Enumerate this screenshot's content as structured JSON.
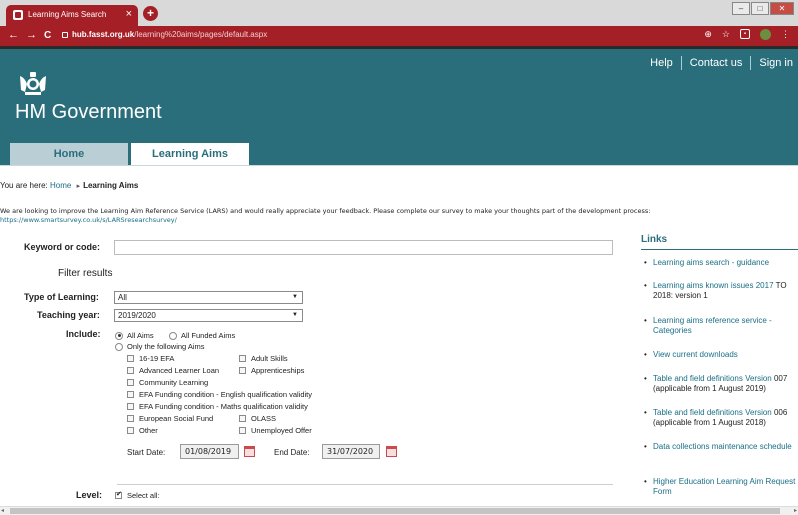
{
  "browser": {
    "tab_title": "Learning Aims Search",
    "tab_close": "×",
    "new_tab": "+",
    "back": "←",
    "forward": "→",
    "reload": "C",
    "url_host": "hub.fasst.org.uk",
    "url_path": "/learning%20aims/pages/default.aspx"
  },
  "header": {
    "gov_name": "HM Government",
    "top_links": [
      "Help",
      "Contact us",
      "Sign in"
    ]
  },
  "nav": {
    "tabs": [
      "Home",
      "Learning Aims"
    ]
  },
  "breadcrumb": {
    "prefix": "You are here:",
    "home": "Home",
    "arrow": "▸",
    "current": "Learning Aims"
  },
  "survey": {
    "text": "We are looking to improve the Learning Aim Reference Service (LARS) and would really appreciate your feedback. Please complete our survey to make your thoughts part of the development process:",
    "url": "https://www.smartsurvey.co.uk/s/LARSresearchsurvey/"
  },
  "form": {
    "keyword_label": "Keyword or code:",
    "keyword_value": "",
    "filter_title": "Filter results",
    "type_label": "Type of Learning:",
    "type_value": "All",
    "year_label": "Teaching year:",
    "year_value": "2019/2020",
    "include_label": "Include:",
    "include_all": "All Aims",
    "include_funded": "All Funded Aims",
    "include_only": "Only the following Aims",
    "aims": {
      "efa": "16-19 EFA",
      "adult": "Adult Skills",
      "loan": "Advanced Learner Loan",
      "appr": "Apprenticeships",
      "community": "Community Learning",
      "efa_english": "EFA Funding condition - English qualification validity",
      "efa_maths": "EFA Funding condition - Maths qualification validity",
      "esf": "European Social Fund",
      "olass": "OLASS",
      "other": "Other",
      "unemployed": "Unemployed Offer"
    },
    "start_label": "Start Date:",
    "start_value": "01/08/2019",
    "end_label": "End Date:",
    "end_value": "31/07/2020",
    "level_label": "Level:",
    "select_all": "Select all:"
  },
  "links": {
    "heading": "Links",
    "items": [
      {
        "link": "Learning aims search - guidance",
        "tail": ""
      },
      {
        "link": "Learning aims known issues 2017",
        "tail": "TO 2018: version 1"
      },
      {
        "link": "Learning aims reference service - Categories",
        "tail": ""
      },
      {
        "link": "View current downloads",
        "tail": ""
      },
      {
        "link": "Table and field definitions Version",
        "tail": "007 (applicable from 1 August 2019)"
      },
      {
        "link": "Table and field definitions Version",
        "tail": "006 (applicable from 1 August 2018)"
      },
      {
        "link": "Data collections maintenance schedule",
        "tail": ""
      },
      {
        "link": "Higher Education Learning Aim Request Form",
        "tail": ""
      }
    ]
  }
}
